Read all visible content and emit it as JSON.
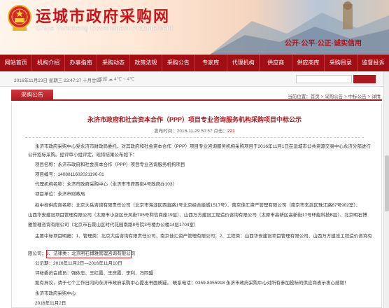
{
  "header": {
    "title": "运城市政府采购网",
    "subtitle": "China Yuncheng Government Procurement",
    "slogan": "公开·公平·公正·诚实信用"
  },
  "nav": [
    "网站首页",
    "机构介绍",
    "办事指南",
    "采购动态",
    "政策法规",
    "采购公告",
    "专家库",
    "代理机构",
    "供应商",
    "供应商库",
    "采购目录",
    "监督投诉"
  ],
  "infobar": {
    "date": "2016年11月23日 星期三 23:47:27 十月廿四",
    "weather": "运城 ☁ 4℃ ~ 4℃",
    "search_placeholder": "",
    "search_button": ""
  },
  "section": {
    "tab": "采购公告",
    "breadcrumb": "当前位置：首页 > 采购公告 > 中标公告 > 详情"
  },
  "article": {
    "title": "永济市政府和社会资本合作（PPP）项目专业咨询服务机构采购项目中标公示",
    "meta_prefix": "发布时间：2016-11-29 50:57  点击：",
    "count": "221",
    "lines": [
      "永济市政府采购中心受永济市财政局委托，对其政府和社会资本合作（PPP）项目专业咨询服务机构采购项目于2016年11月1日在运城市公共资源交易中心永济分部进行",
      "公开招标采购。经评审小组评定，现将结果公布如下：",
      "项目名称：永济市政府和社会资本合作（PPP）项目专业咨询服务机构项目",
      "项目编号：1408811602021196-01",
      "代理机构名称：永济市政府采购中心（永济市市府西街4号政府办103）",
      "项目单位：永济市财政局",
      "拟中标供应商名称：北京大岳咨询有限责任公司（北京市海淀区西直路1号北京经合能城1517号）、南京佳汇资产管理有限公司（南京市玄武区珠江路67号902室）、",
      "山西华安建设项目管理有限公司（太原市小店区长风街705号和信商座19层）、山西万方建设工程造价咨询有限公司（太原市高新区高新街17号环能科技B层）、北京明石博",
      "雅管理咨询有限公司（北京市石景山区时代花园南路8号院3号楼办公楼14层1704室）",
      "主要中标项目明细：1、管理类：北京大岳咨询有限责任公司、南京佳汇资产管理有限公司；2、工程类：山西华安建设项目管理有限公司、山西万方建设工程造价咨询有",
      "限公司；3、法律类：北京明石博雅管理咨询有限公司",
      "公示期：2016年11月2日—2016年11月10日",
      "评标委员会成员：强依忠、王红霞、王庆霞、李利、冯四盟",
      "如有异议，请于七个工作日内向永济市政府采购中心提出书面质疑。  联系电话：0359-8055918  永济市政府采购中心对所有参加投标的供应商表示衷心感谢！",
      "永济市政府采购中心",
      "2016年11月2日"
    ]
  }
}
